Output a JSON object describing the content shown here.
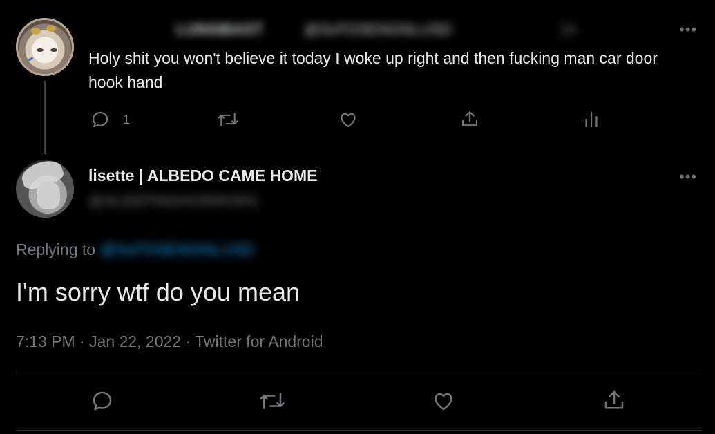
{
  "parent_tweet": {
    "display_name_redacted": "LUNSIBAST",
    "handle_redacted": "@ScFDSENGNLUSD",
    "time_redacted": "1h",
    "text": "Holy shit you won't believe it today I woke up right and then fucking man car door hook hand",
    "reply_count": "1",
    "more_label": "•••",
    "icons": [
      "reply-icon",
      "retweet-icon",
      "like-icon",
      "share-icon",
      "analytics-icon"
    ]
  },
  "main_tweet": {
    "display_name": "lisette | ALBEDO CAME HOME",
    "handle_redacted": "@SLEEPINGHORRORS",
    "replying_label": "Replying to",
    "replying_handle_redacted": "@ScFDSENGNLUSD",
    "text": "I'm sorry wtf do you mean",
    "timestamp": "7:13 PM · Jan 22, 2022 · Twitter for Android",
    "more_label": "•••",
    "icons": [
      "reply-icon",
      "retweet-icon",
      "like-icon",
      "share-icon"
    ]
  },
  "colors": {
    "background": "#000000",
    "text": "#e7e9ea",
    "muted": "#71767b",
    "link": "#1d9bf0",
    "divider": "#2f3336"
  }
}
